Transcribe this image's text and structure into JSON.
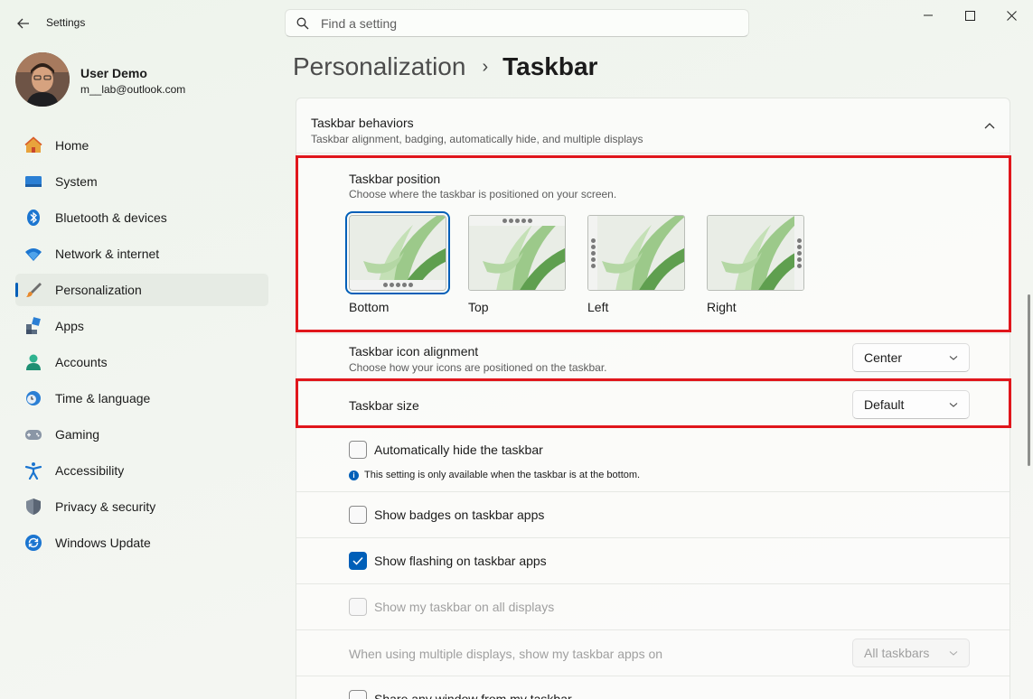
{
  "window": {
    "app_title": "Settings",
    "search_placeholder": "Find a setting"
  },
  "user": {
    "name": "User Demo",
    "email": "m__lab@outlook.com"
  },
  "sidebar": {
    "items": [
      {
        "label": "Home",
        "icon": "home-icon"
      },
      {
        "label": "System",
        "icon": "monitor-icon"
      },
      {
        "label": "Bluetooth & devices",
        "icon": "bluetooth-icon"
      },
      {
        "label": "Network & internet",
        "icon": "wifi-icon"
      },
      {
        "label": "Personalization",
        "icon": "brush-icon",
        "active": true
      },
      {
        "label": "Apps",
        "icon": "apps-icon"
      },
      {
        "label": "Accounts",
        "icon": "person-icon"
      },
      {
        "label": "Time & language",
        "icon": "clock-globe-icon"
      },
      {
        "label": "Gaming",
        "icon": "gamepad-icon"
      },
      {
        "label": "Accessibility",
        "icon": "accessibility-icon"
      },
      {
        "label": "Privacy & security",
        "icon": "shield-icon"
      },
      {
        "label": "Windows Update",
        "icon": "update-icon"
      }
    ]
  },
  "breadcrumb": {
    "parent": "Personalization",
    "separator": "›",
    "current": "Taskbar"
  },
  "behaviors": {
    "title": "Taskbar behaviors",
    "description": "Taskbar alignment, badging, automatically hide, and multiple displays",
    "position": {
      "title": "Taskbar position",
      "description": "Choose where the taskbar is positioned on your screen.",
      "options": [
        {
          "label": "Bottom",
          "selected": true
        },
        {
          "label": "Top",
          "selected": false
        },
        {
          "label": "Left",
          "selected": false
        },
        {
          "label": "Right",
          "selected": false
        }
      ]
    },
    "alignment": {
      "title": "Taskbar icon alignment",
      "description": "Choose how your icons are positioned on the taskbar.",
      "value": "Center"
    },
    "size": {
      "title": "Taskbar size",
      "value": "Default"
    },
    "auto_hide": {
      "label": "Automatically hide the taskbar",
      "checked": false,
      "note": "This setting is only available when the taskbar is at the bottom."
    },
    "badges": {
      "label": "Show badges on taskbar apps",
      "checked": false
    },
    "flashing": {
      "label": "Show flashing on taskbar apps",
      "checked": true
    },
    "all_displays": {
      "label": "Show my taskbar on all displays",
      "checked": false,
      "disabled": true
    },
    "multi_display": {
      "label": "When using multiple displays, show my taskbar apps on",
      "value": "All taskbars",
      "disabled": true
    },
    "share_window": {
      "label": "Share any window from my taskbar",
      "checked": false
    }
  },
  "colors": {
    "accent": "#005fb8",
    "highlight": "#e0161c"
  }
}
